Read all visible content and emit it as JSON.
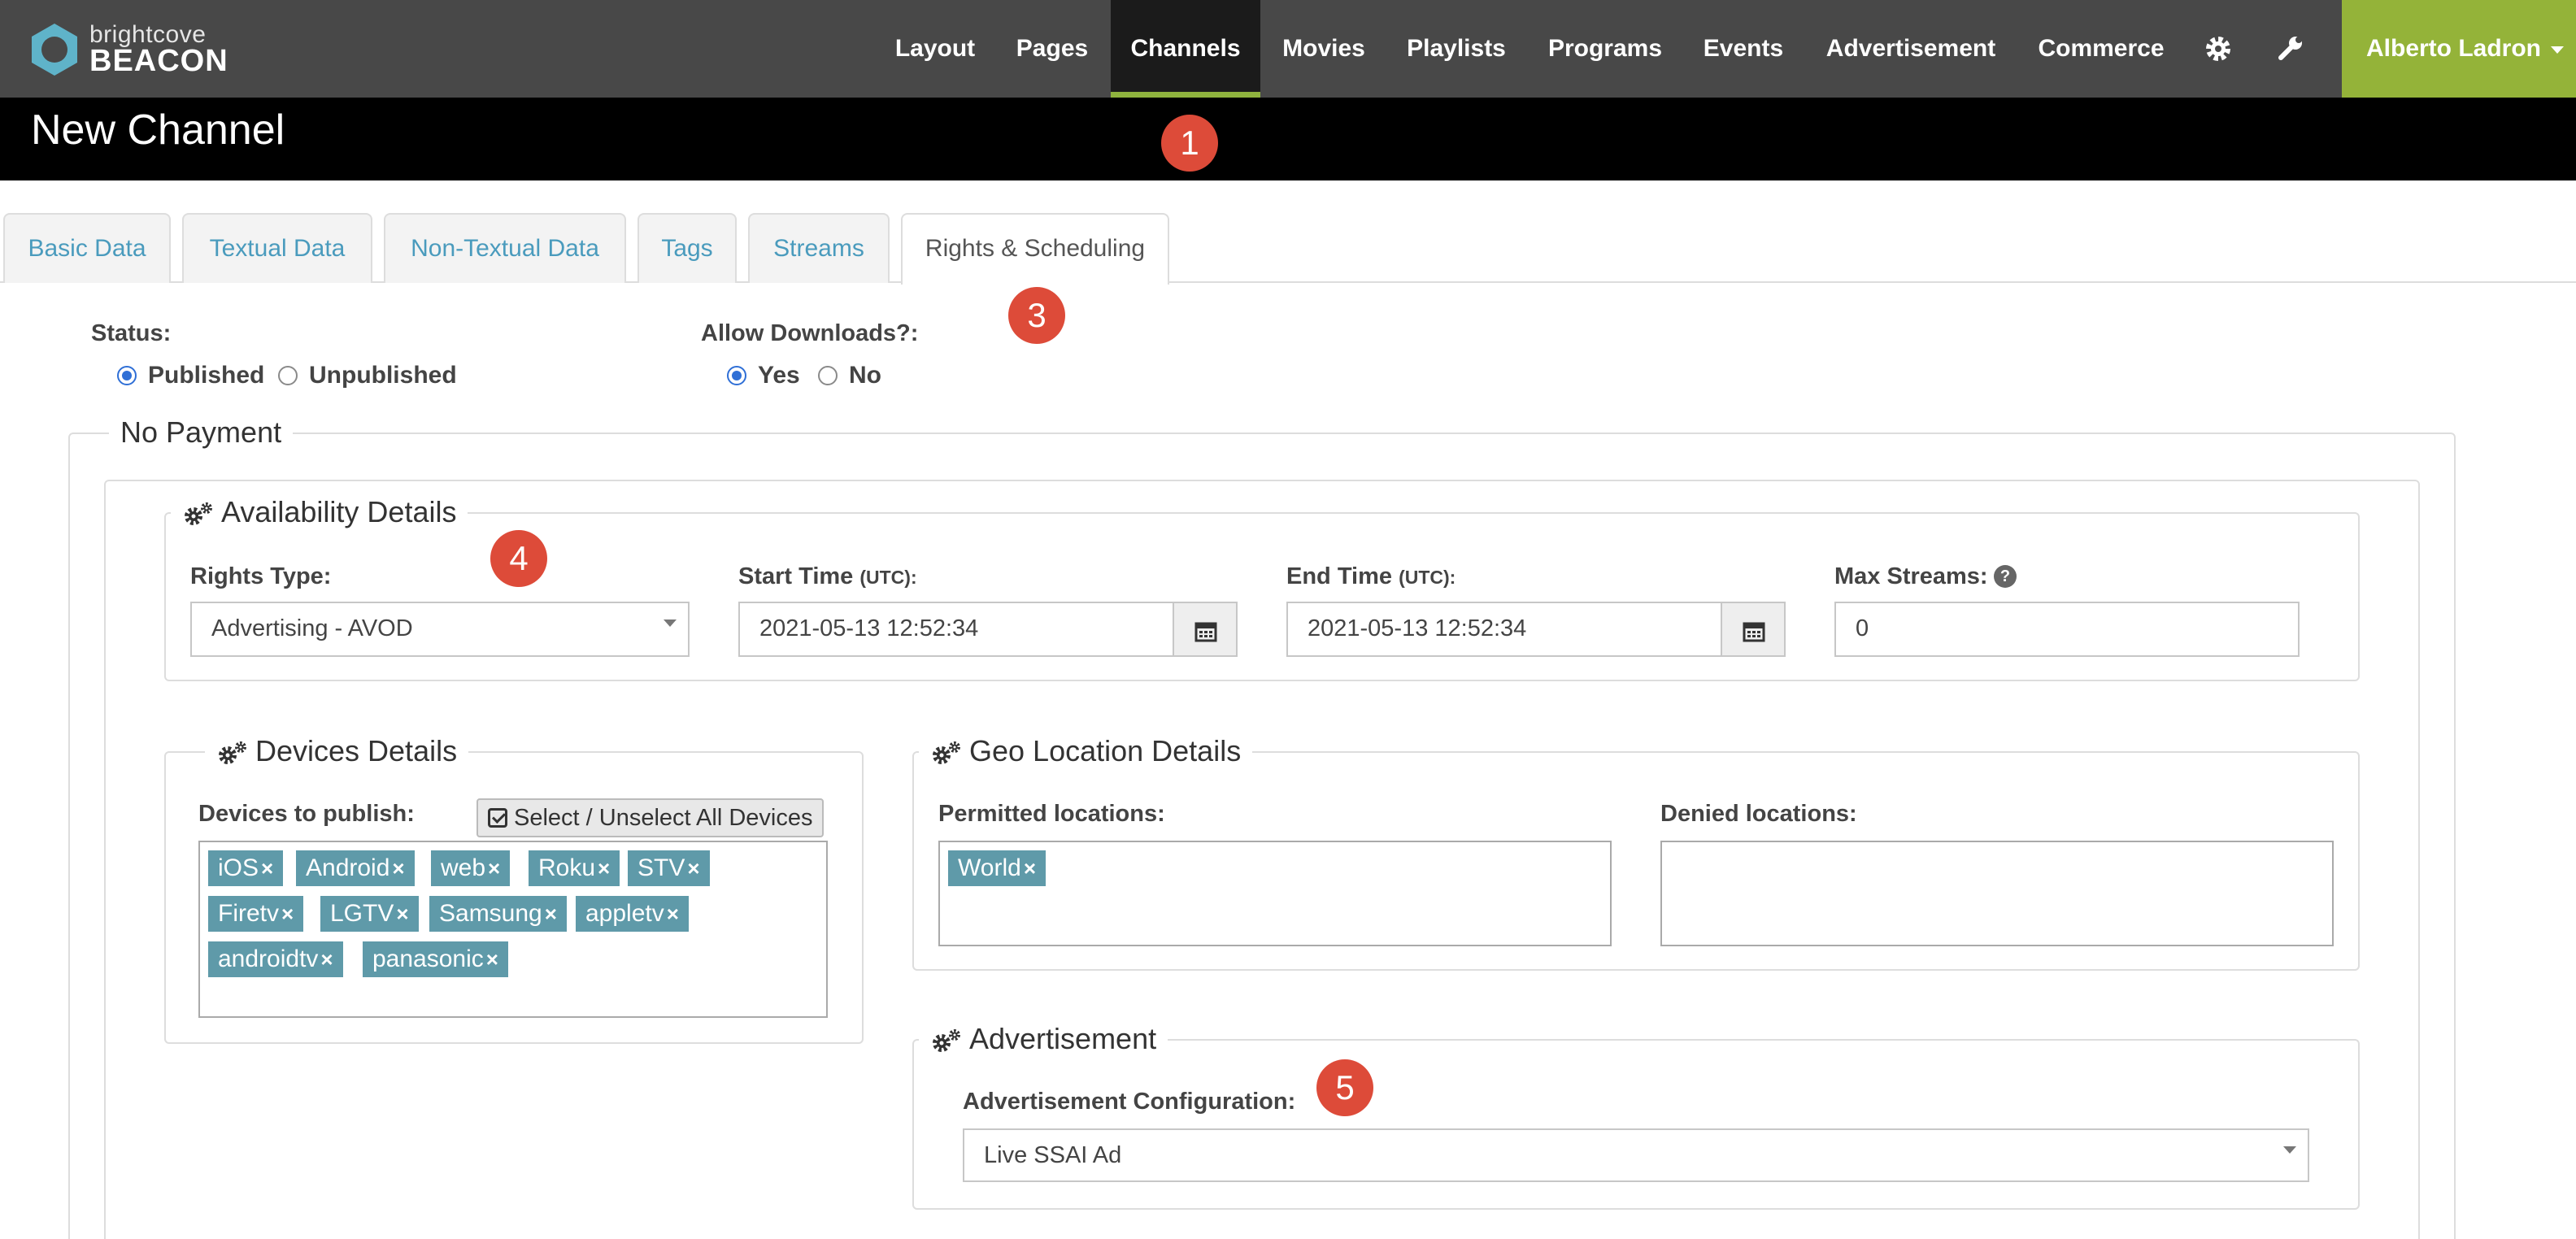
{
  "brand": {
    "line1": "brightcove",
    "line2": "BEACON"
  },
  "nav": {
    "items": [
      {
        "label": "Layout"
      },
      {
        "label": "Pages"
      },
      {
        "label": "Channels",
        "active": true
      },
      {
        "label": "Movies"
      },
      {
        "label": "Playlists"
      },
      {
        "label": "Programs"
      },
      {
        "label": "Events"
      },
      {
        "label": "Advertisement"
      },
      {
        "label": "Commerce"
      }
    ],
    "icons": [
      "gear-icon",
      "wrench-icon"
    ],
    "user": "Alberto Ladron"
  },
  "page": {
    "title": "New Channel"
  },
  "badges": [
    "1",
    "3",
    "4",
    "5"
  ],
  "tabs": [
    {
      "label": "Basic Data"
    },
    {
      "label": "Textual Data"
    },
    {
      "label": "Non-Textual Data"
    },
    {
      "label": "Tags"
    },
    {
      "label": "Streams"
    },
    {
      "label": "Rights & Scheduling",
      "active": true
    }
  ],
  "status": {
    "label": "Status:",
    "options": [
      "Published",
      "Unpublished"
    ],
    "selected": "Published"
  },
  "downloads": {
    "label": "Allow Downloads?:",
    "options": [
      "Yes",
      "No"
    ],
    "selected": "Yes"
  },
  "payment": {
    "legend": "No Payment"
  },
  "availability": {
    "legend": "Availability Details",
    "rights_type_label": "Rights Type:",
    "rights_type_value": "Advertising - AVOD",
    "start_label": "Start Time",
    "end_label": "End Time",
    "tz": "(UTC):",
    "start_value": "2021-05-13 12:52:34",
    "end_value": "2021-05-13 12:52:34",
    "max_streams_label": "Max Streams:",
    "max_streams_value": "0"
  },
  "devices": {
    "legend": "Devices Details",
    "label": "Devices to publish:",
    "toggle_all": "Select / Unselect All Devices",
    "tags": [
      "iOS",
      "Android",
      "web",
      "Roku",
      "STV",
      "Firetv",
      "LGTV",
      "Samsung",
      "appletv",
      "androidtv",
      "panasonic"
    ],
    "remove_glyph": "×"
  },
  "geo": {
    "legend": "Geo Location Details",
    "permitted_label": "Permitted locations:",
    "permitted": [
      "World"
    ],
    "denied_label": "Denied locations:"
  },
  "advertisement": {
    "legend": "Advertisement",
    "config_label": "Advertisement Configuration:",
    "config_value": "Live SSAI Ad"
  },
  "colors": {
    "nav_bg": "#484848",
    "accent": "#94b339",
    "tag": "#5f9aa9",
    "badge": "#dd4b39",
    "link": "#4a9bbd"
  }
}
